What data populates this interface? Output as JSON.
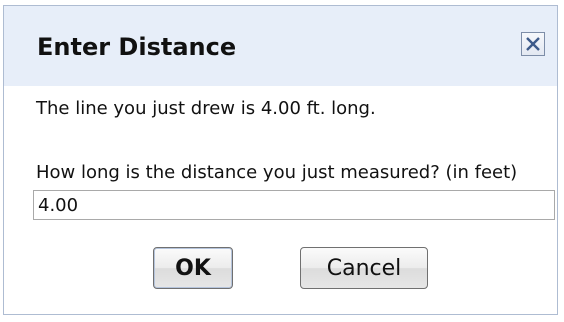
{
  "dialog": {
    "title": "Enter Distance",
    "close_icon": "close-x-icon",
    "message": "The line you just drew is 4.00 ft. long.",
    "prompt": "How long is the distance you just measured? (in feet)",
    "input_value": "4.00",
    "ok_label": "OK",
    "cancel_label": "Cancel"
  },
  "colors": {
    "titlebar_background": "#e7eef9",
    "border": "#aebcd2"
  }
}
